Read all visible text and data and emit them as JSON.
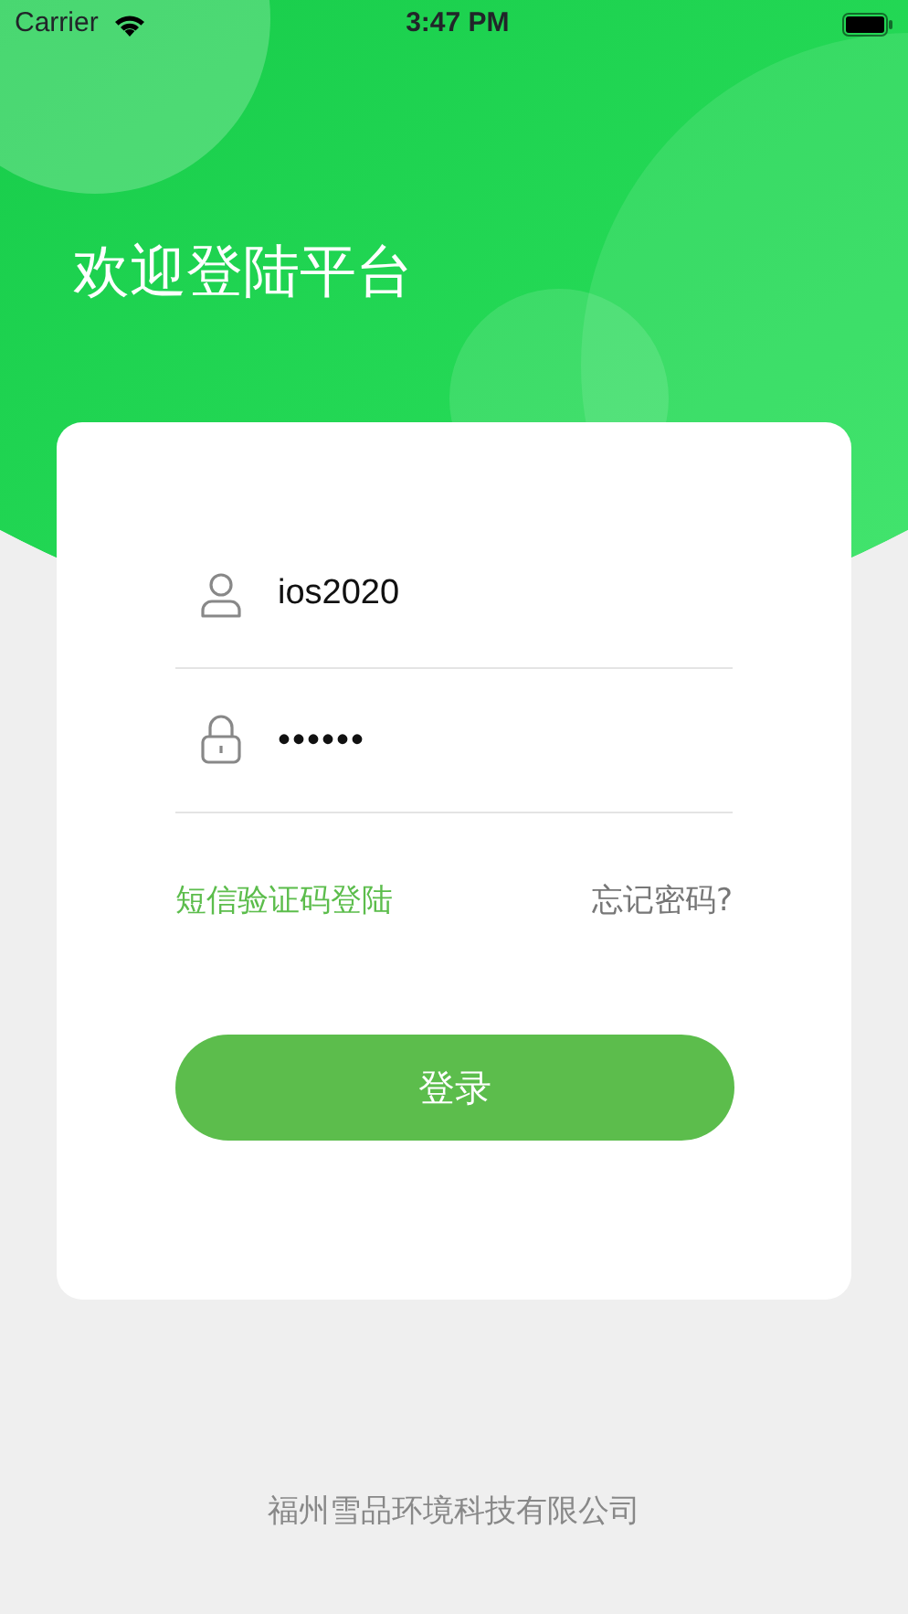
{
  "status_bar": {
    "carrier": "Carrier",
    "time": "3:47 PM"
  },
  "title": "欢迎登陆平台",
  "fields": [
    {
      "kind": "username",
      "value": "ios2020"
    },
    {
      "kind": "password",
      "value": "••••••"
    }
  ],
  "links": [
    {
      "kind": "accent",
      "label": "短信验证码登陆"
    },
    {
      "kind": "muted",
      "label": "忘记密码?"
    }
  ],
  "login_button": "登录",
  "footer": "福州雪品环境科技有限公司"
}
